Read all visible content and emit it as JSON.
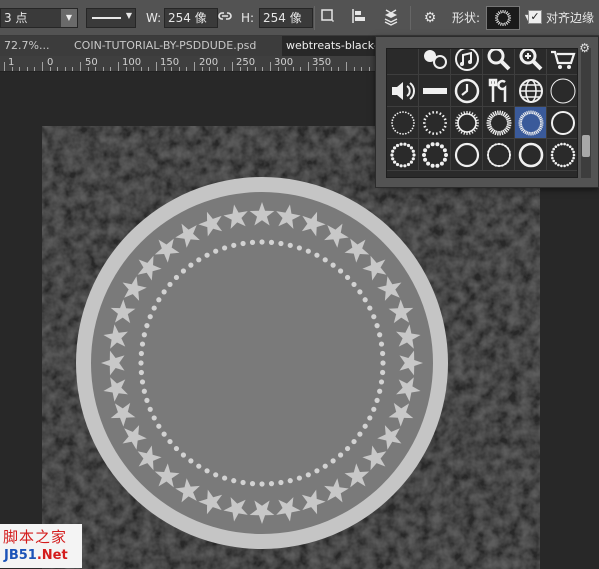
{
  "options_bar": {
    "stroke_size_value": "3 点",
    "width_label": "W:",
    "width_value": "254 像",
    "height_label": "H:",
    "height_value": "254 像",
    "shape_label": "形状:",
    "align_edges_label": "对齐边缘",
    "align_edges_checked": true
  },
  "tabs": [
    {
      "label": "72.7%...",
      "active": false
    },
    {
      "label": "COIN-TUTORIAL-BY-PSDDUDE.psd",
      "active": false
    },
    {
      "label": "webtreats-black-",
      "active": true
    }
  ],
  "ruler": {
    "labels": [
      "1",
      "0",
      "50",
      "100",
      "150",
      "200",
      "250",
      "300",
      "350"
    ]
  },
  "shape_panel": {
    "icons": [
      "weather-icon",
      "music-notes-icon",
      "magnifier-icon",
      "zoom-in-icon",
      "shopping-cart-icon",
      "speaker-icon",
      "bar-icon",
      "clock-icon",
      "tools-icon",
      "globe-icon",
      "circle-frame-icon",
      "dotted-ring-icon",
      "dashed-ring-icon",
      "spiked-ring-icon",
      "sunburst-ring-icon",
      "starburst-ring-icon",
      "ring-icon",
      "bead-ring-icon",
      "bead-ring-2-icon",
      "dot-ring-icon",
      "dot-ring-2-icon",
      "dot-ring-3-icon",
      "dot-ring-4-icon"
    ],
    "selected_index": 15
  },
  "watermark": {
    "line1": "脚本之家",
    "line2_prefix": "JB51",
    "line2_suffix": ".Net"
  },
  "colors": {
    "coin_outer": "#c5c5c5",
    "coin_inner": "#7a7a7a",
    "stars": "#c8c8c8",
    "ui_bar": "#535353",
    "selection": "#3a5a9a"
  }
}
